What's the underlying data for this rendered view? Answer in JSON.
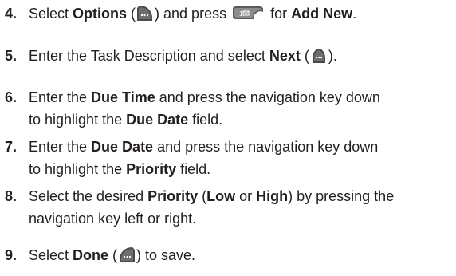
{
  "steps": [
    {
      "number": "4.",
      "parts": {
        "t1": "Select ",
        "b1": "Options",
        "t2": " (",
        "t3": ") and press ",
        "t4": " for ",
        "b2": "Add New",
        "t5": "."
      },
      "icons": [
        "softkey-right-icon",
        "key-1-icon"
      ]
    },
    {
      "number": "5.",
      "parts": {
        "t1": "Enter the Task Description and select ",
        "b1": "Next",
        "t2": " (",
        "t3": ")."
      },
      "icons": [
        "softkey-center-icon"
      ]
    },
    {
      "number": "6.",
      "parts": {
        "t1": "Enter the ",
        "b1": "Due Time",
        "t2": " and press the navigation key down",
        "t3": "to highlight the ",
        "b2": "Due Date",
        "t4": " field."
      }
    },
    {
      "number": "7.",
      "parts": {
        "t1": "Enter the ",
        "b1": "Due Date",
        "t2": " and press the navigation key down",
        "t3": "to highlight the ",
        "b2": "Priority",
        "t4": " field."
      }
    },
    {
      "number": "8.",
      "parts": {
        "t1": "Select the desired ",
        "b1": "Priority",
        "t2": " (",
        "b2": "Low",
        "t3": " or ",
        "b3": "High",
        "t4": ") by pressing the",
        "t5": "navigation key left or right."
      }
    },
    {
      "number": "9.",
      "parts": {
        "t1": "Select ",
        "b1": "Done",
        "t2": " (",
        "t3": ") to save."
      },
      "icons": [
        "softkey-left-icon"
      ]
    }
  ],
  "colors": {
    "text": "#231f20",
    "key_dark": "#4a4a4a",
    "key_mid": "#8c8c8c"
  }
}
